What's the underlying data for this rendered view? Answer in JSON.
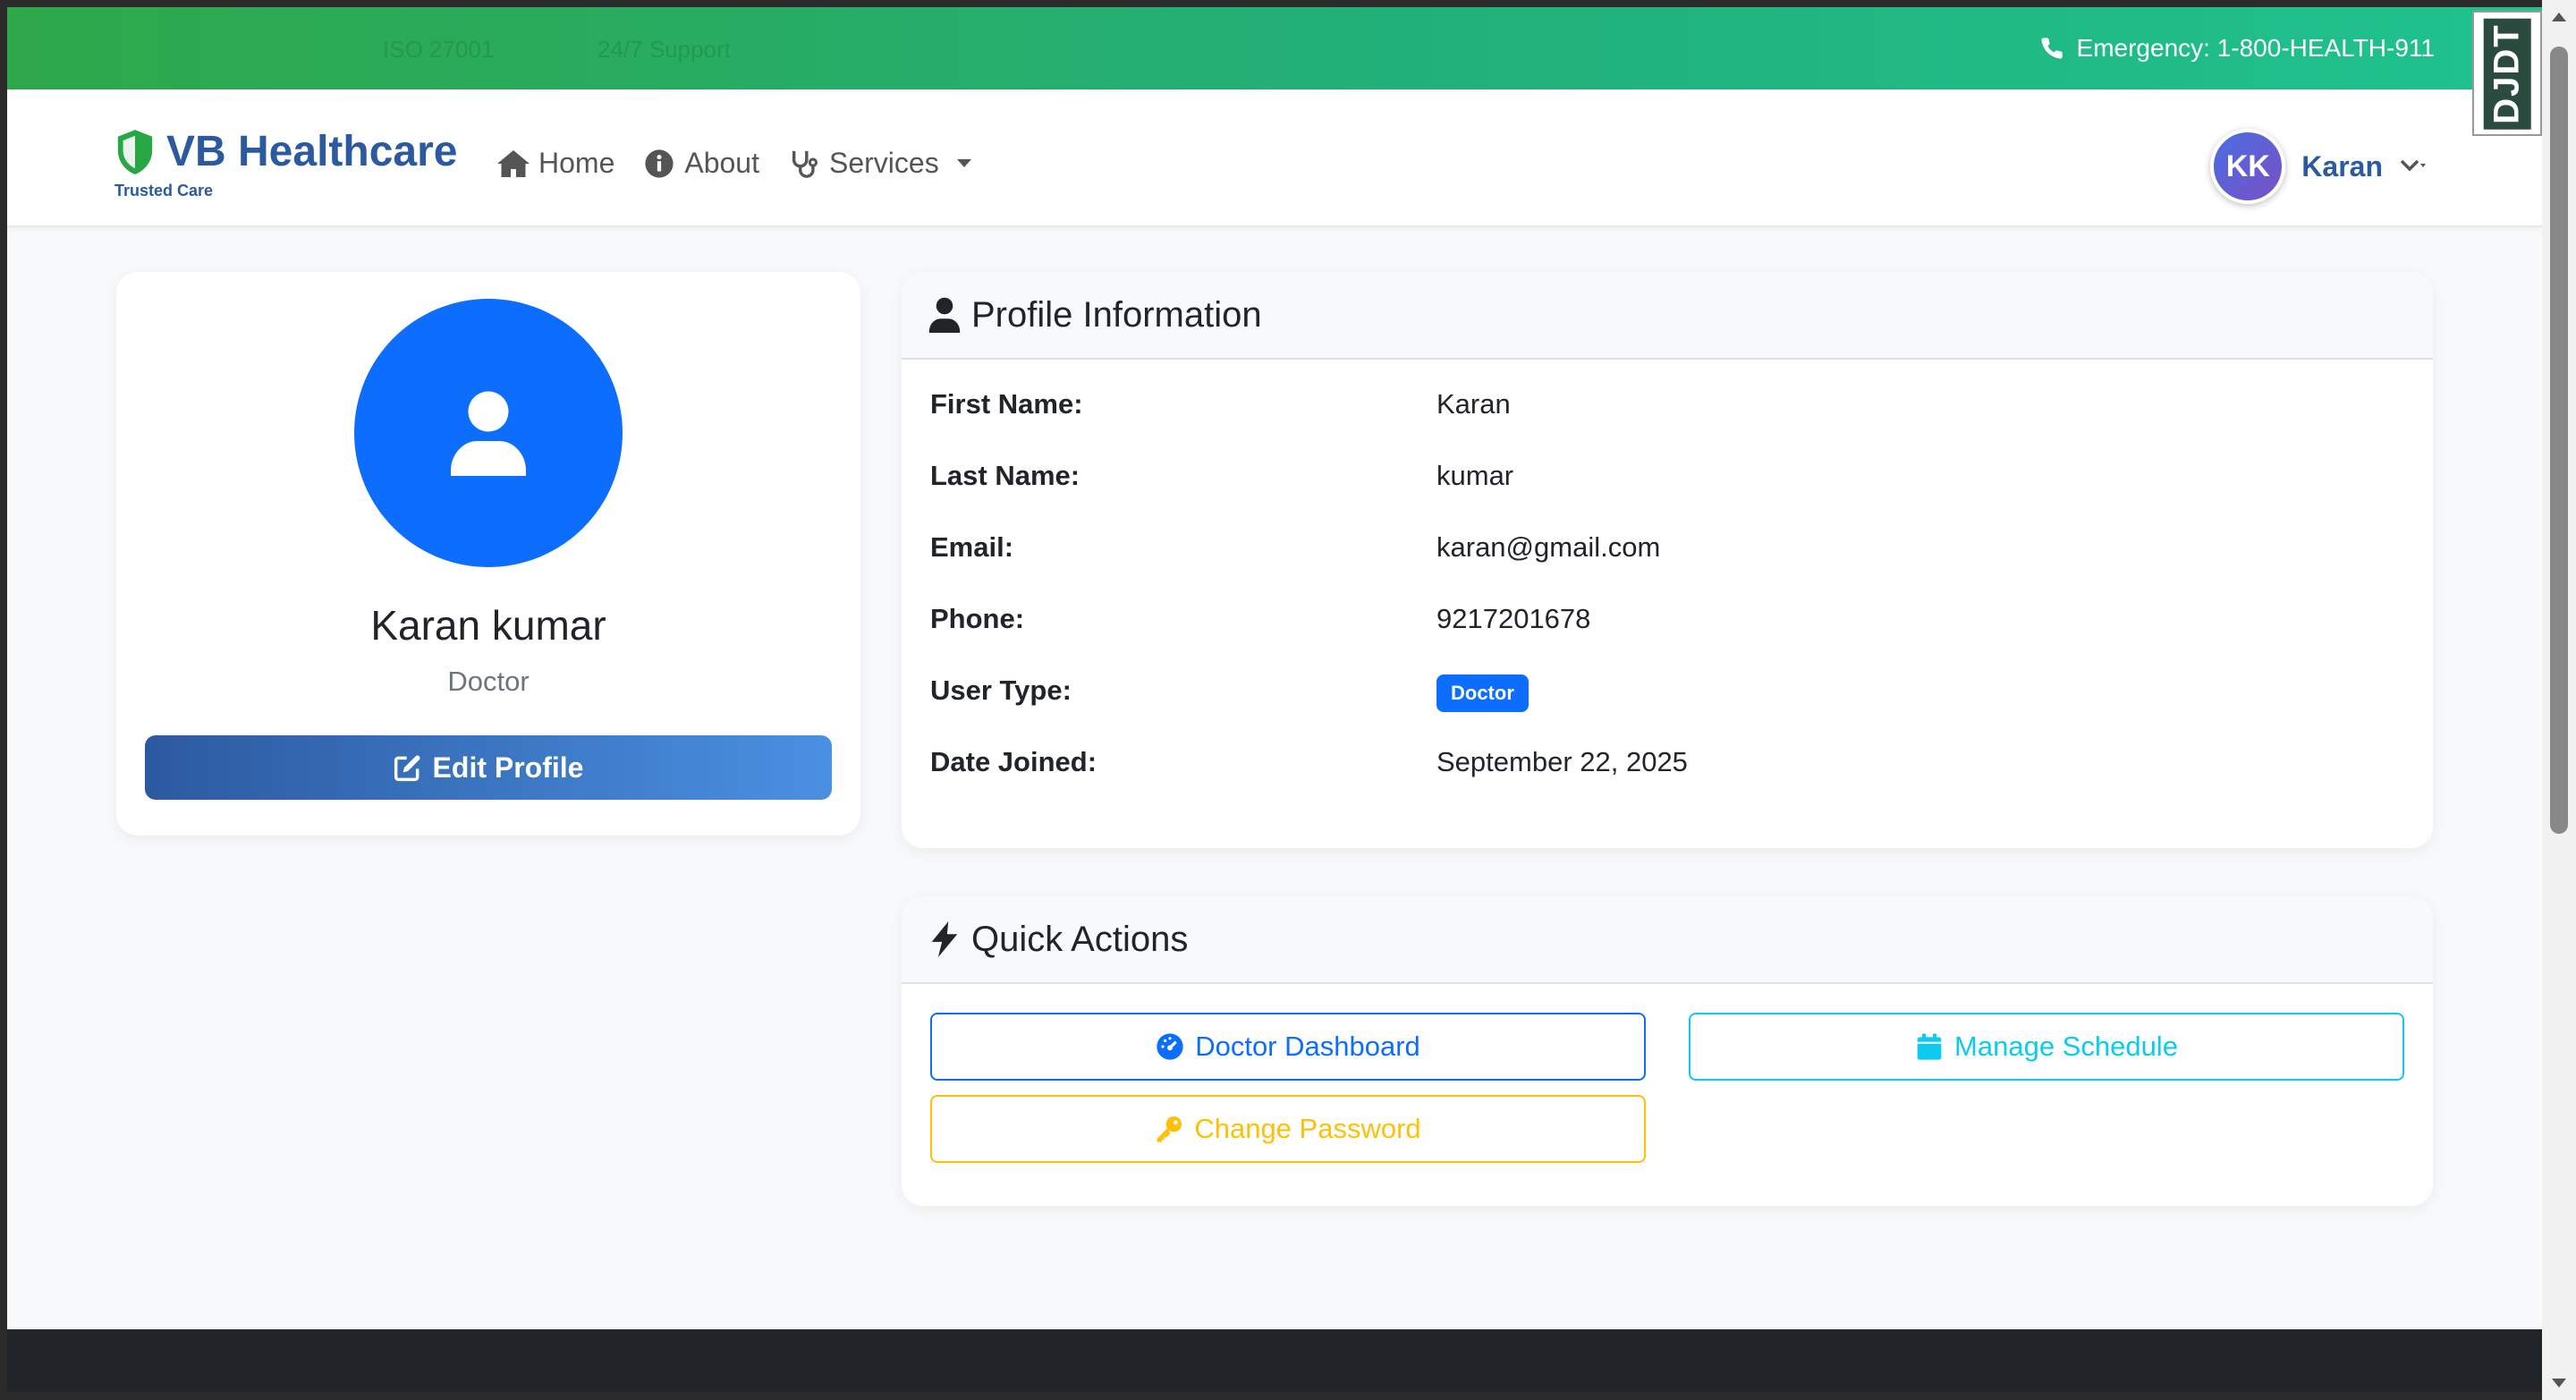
{
  "topbar": {
    "faint_items": [
      "",
      "",
      "ISO 27001",
      "24/7 Support"
    ],
    "emergency_text": "Emergency: 1-800-HEALTH-911",
    "icon": "phone-icon"
  },
  "debug_toolbar": {
    "label": "DJDT"
  },
  "navbar": {
    "brand_name": "VB Healthcare",
    "brand_tagline": "Trusted Care",
    "links": [
      {
        "label": "Home",
        "icon": "home-icon"
      },
      {
        "label": "About",
        "icon": "info-icon"
      },
      {
        "label": "Services",
        "icon": "stethoscope-icon"
      }
    ],
    "user": {
      "initials": "KK",
      "name": "Karan"
    }
  },
  "profile": {
    "full_name": "Karan kumar",
    "role": "Doctor",
    "edit_label": "Edit Profile"
  },
  "info": {
    "title": "Profile Information",
    "rows": [
      {
        "label": "First Name:",
        "value": "Karan"
      },
      {
        "label": "Last Name:",
        "value": "kumar"
      },
      {
        "label": "Email:",
        "value": "karan@gmail.com"
      },
      {
        "label": "Phone:",
        "value": "9217201678"
      },
      {
        "label": "User Type:",
        "value": "Doctor"
      },
      {
        "label": "Date Joined:",
        "value": "September 22, 2025"
      }
    ]
  },
  "actions": {
    "title": "Quick Actions",
    "dashboard": "Doctor Dashboard",
    "schedule": "Manage Schedule",
    "password": "Change Password"
  },
  "colors": {
    "brand": "#2c5aa0",
    "primary": "#0d6efd",
    "info": "#0dcaf0",
    "warning": "#ffc107",
    "topbar_green": "#22b07a"
  }
}
